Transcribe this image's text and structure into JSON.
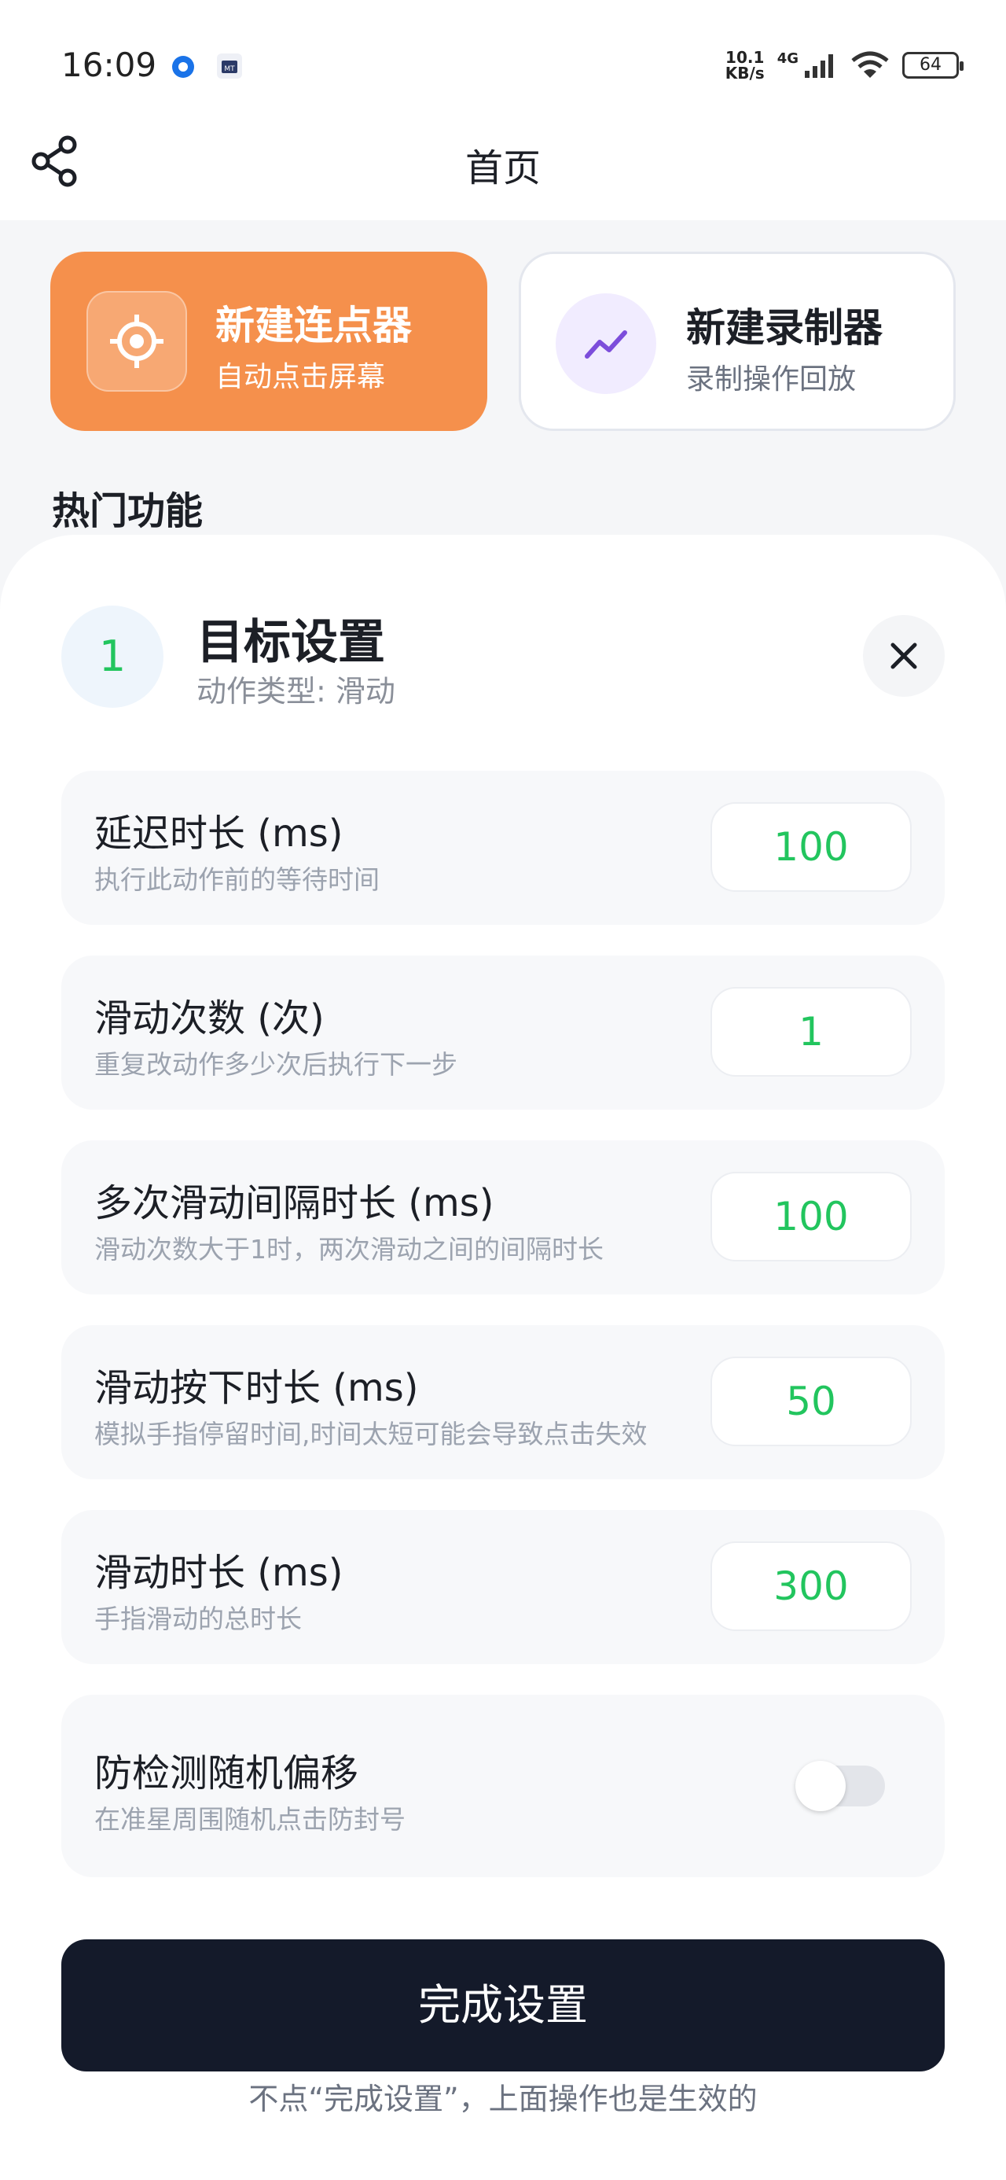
{
  "status_bar": {
    "time": "16:09",
    "net_speed_value": "10.1",
    "net_speed_unit": "KB/s",
    "network_type": "4G",
    "battery": "64"
  },
  "header": {
    "title": "首页"
  },
  "cards": [
    {
      "title": "新建连点器",
      "subtitle": "自动点击屏幕",
      "icon": "crosshair-icon",
      "color": "#f5904c"
    },
    {
      "title": "新建录制器",
      "subtitle": "录制操作回放",
      "icon": "trend-line-icon",
      "color": "#7c4ddb"
    }
  ],
  "section_title": "热门功能",
  "sheet": {
    "step_number": "1",
    "title": "目标设置",
    "subtitle": "动作类型: 滑动",
    "rows": [
      {
        "title": "延迟时长 (ms)",
        "desc": "执行此动作前的等待时间",
        "value": "100"
      },
      {
        "title": "滑动次数 (次)",
        "desc": "重复改动作多少次后执行下一步",
        "value": "1"
      },
      {
        "title": "多次滑动间隔时长 (ms)",
        "desc": "滑动次数大于1时，两次滑动之间的间隔时长",
        "value": "100"
      },
      {
        "title": "滑动按下时长 (ms)",
        "desc": "模拟手指停留时间,时间太短可能会导致点击失效",
        "value": "50"
      },
      {
        "title": "滑动时长 (ms)",
        "desc": "手指滑动的总时长",
        "value": "300"
      }
    ],
    "toggle_row": {
      "title": "防检测随机偏移",
      "desc": "在准星周围随机点击防封号",
      "enabled": false
    },
    "done_button": "完成设置",
    "footer_note": "不点“完成设置”，上面操作也是生效的"
  },
  "colors": {
    "accent_green": "#22c55e",
    "orange": "#f5904c",
    "dark_button": "#141a2a"
  }
}
